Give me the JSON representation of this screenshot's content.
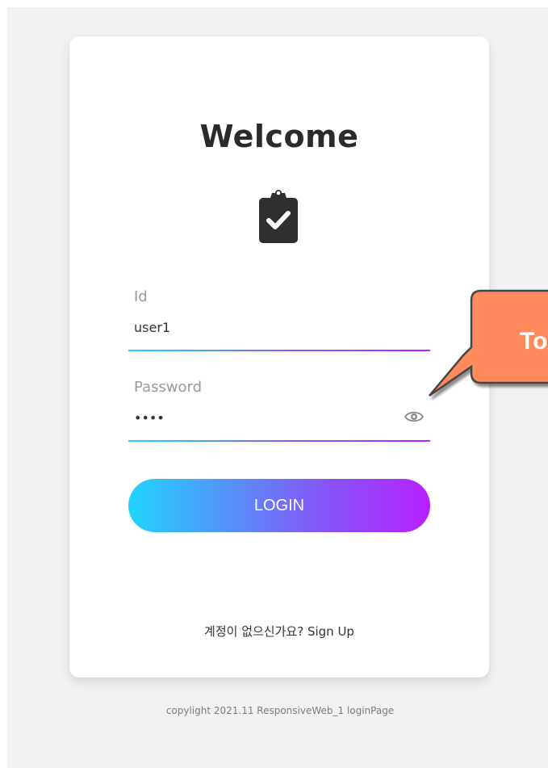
{
  "card": {
    "title": "Welcome",
    "icon": "clipboard-check-icon"
  },
  "form": {
    "id_field": {
      "label": "Id",
      "value": "user1"
    },
    "password_field": {
      "label": "Password",
      "value": "••••",
      "toggle_icon": "eye-icon"
    },
    "login_label": "LOGIN"
  },
  "signup": {
    "prompt": "계정이 없으신가요?",
    "link_label": "Sign Up"
  },
  "footer": {
    "copyright": "copylight 2021.11 ResponsiveWeb_1 loginPage"
  },
  "callout": {
    "text": "To"
  },
  "colors": {
    "gradient_start": "#21d4fd",
    "gradient_end": "#b721ff",
    "callout_fill": "#ff8a5c",
    "background": "#f2f2f2"
  }
}
